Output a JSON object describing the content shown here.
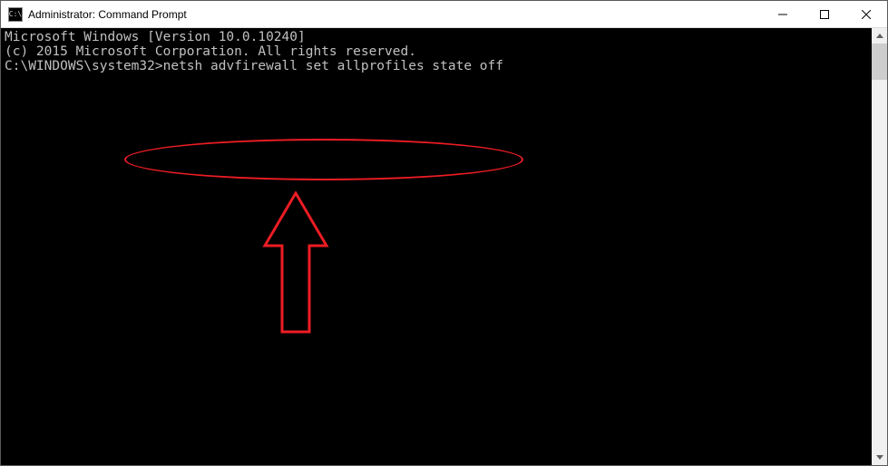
{
  "window": {
    "title": "Administrator: Command Prompt",
    "icon_text": "C:\\"
  },
  "terminal": {
    "line1": "Microsoft Windows [Version 10.0.10240]",
    "line2": "(c) 2015 Microsoft Corporation. All rights reserved.",
    "line3": "",
    "prompt": "C:\\WINDOWS\\system32>",
    "command": "netsh advfirewall set allprofiles state off"
  },
  "annotation": {
    "color": "#ed1c24"
  }
}
